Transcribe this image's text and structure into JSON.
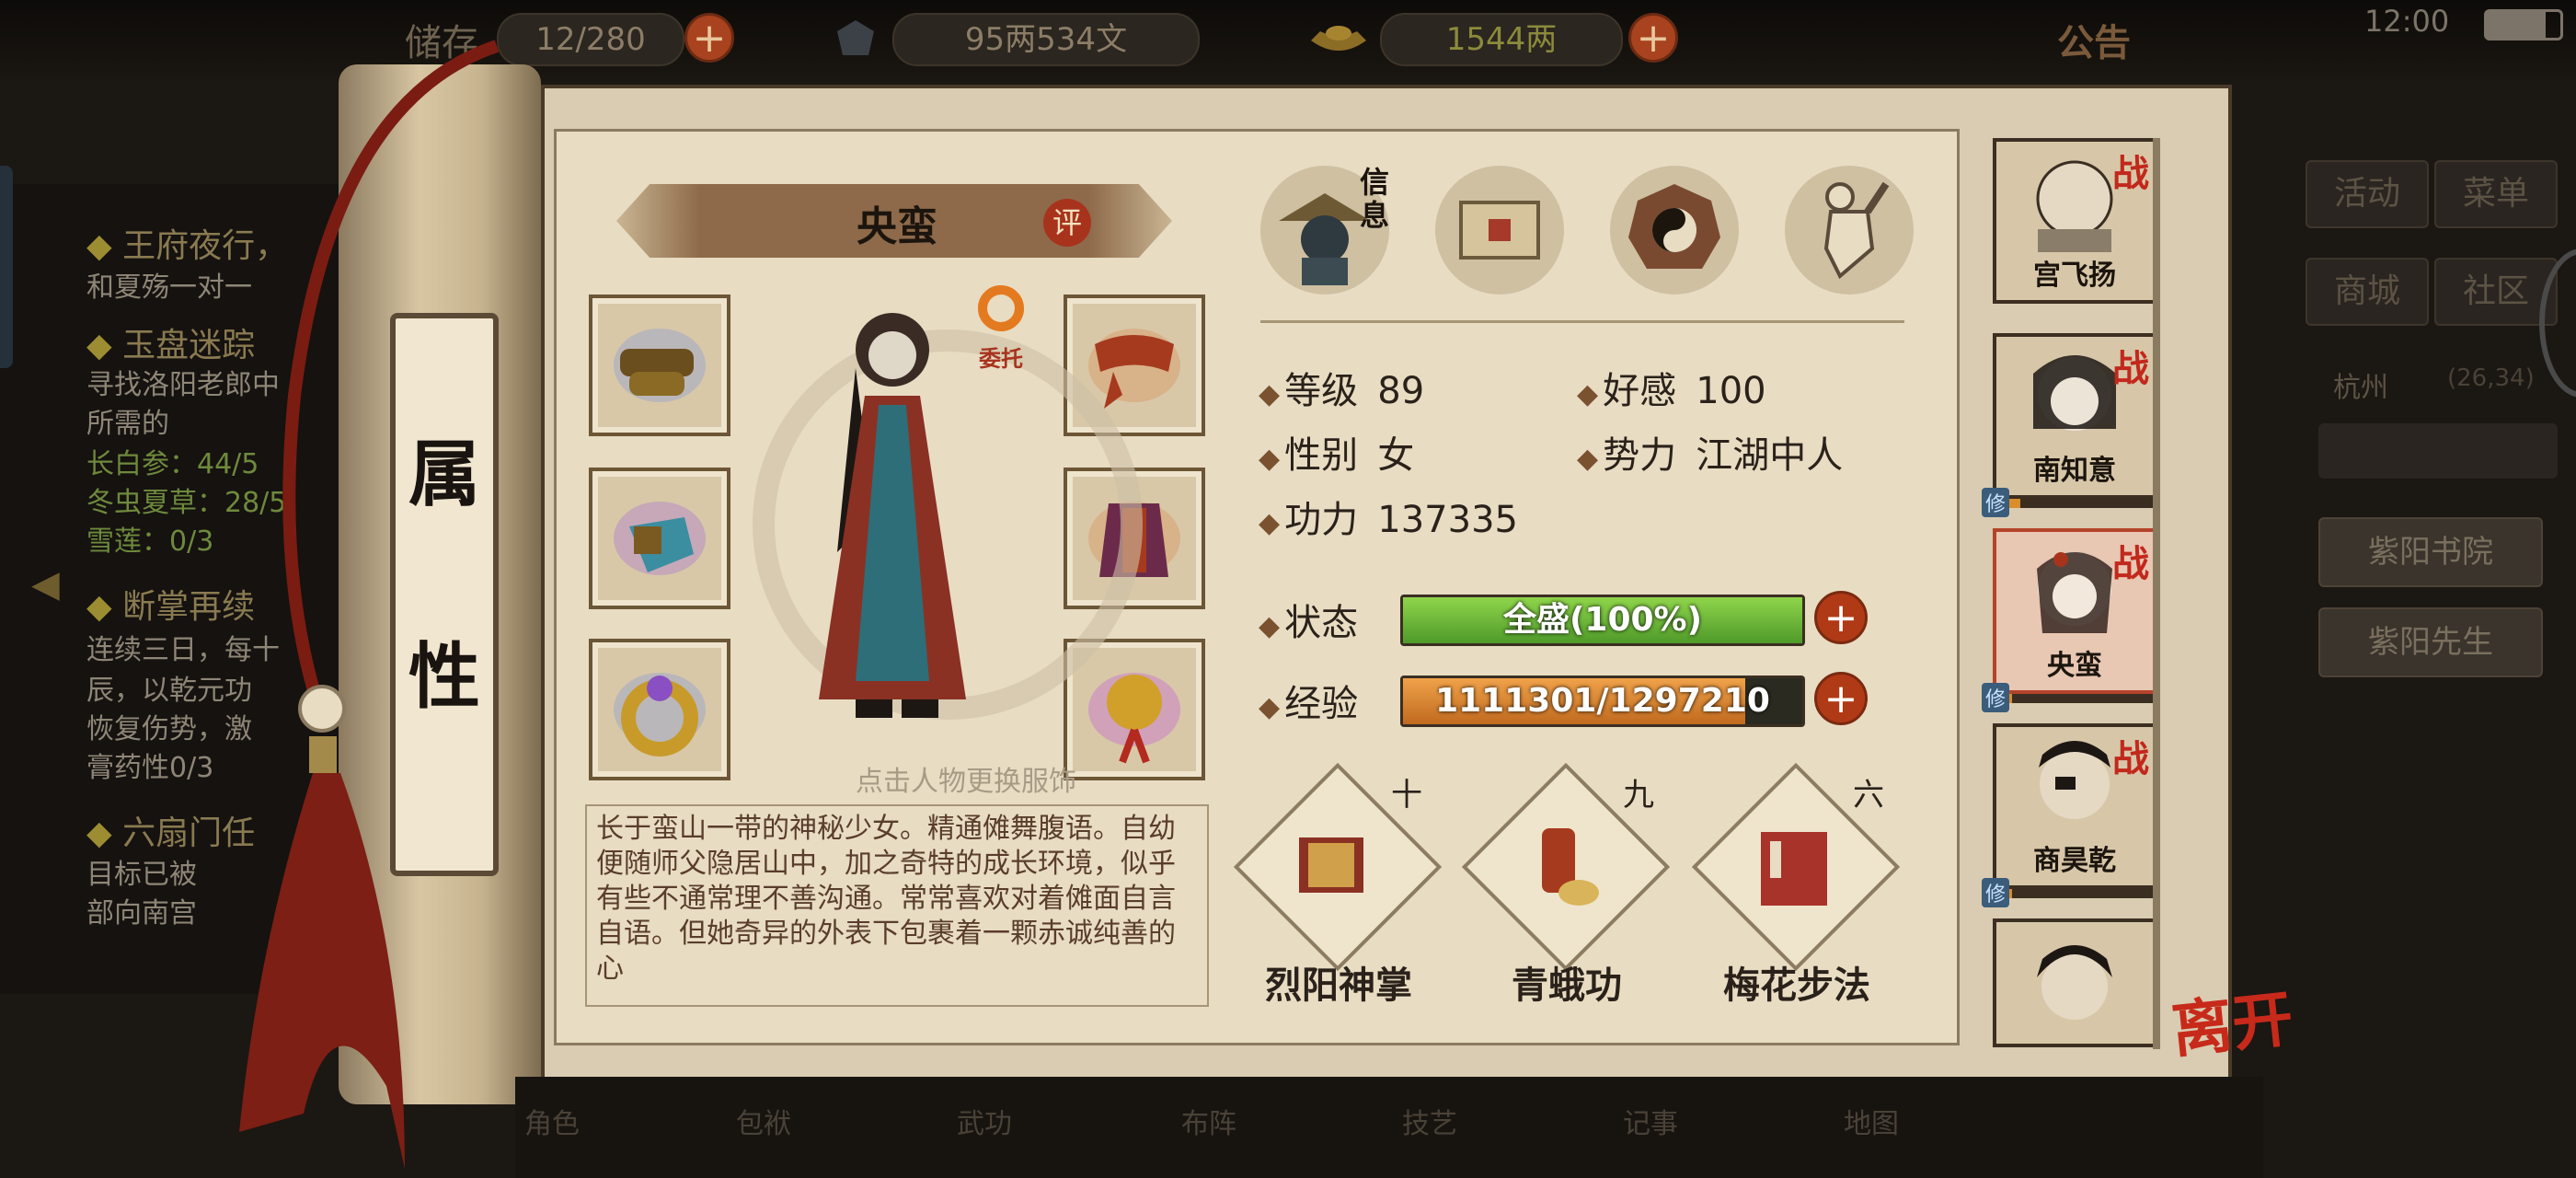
{
  "topbar": {
    "storage": "12/280",
    "money": "95两534文",
    "gold": "1544两",
    "announcement": "公告",
    "clock": "12:00"
  },
  "quests": [
    {
      "title": "王府夜行，",
      "body": [
        "和夏殇一对一"
      ]
    },
    {
      "title": "玉盘迷踪",
      "body": [
        "寻找洛阳老郎中",
        "所需的"
      ],
      "items": [
        "长白参：44/5",
        "冬虫夏草：28/5",
        "雪莲：0/3"
      ]
    },
    {
      "title": "断掌再续",
      "body": [
        "连续三日，每十",
        "辰，以乾元功",
        "恢复伤势，激",
        "膏药性0/3"
      ]
    },
    {
      "title": "六扇门任",
      "body": [
        "目标已被",
        "部向南宫"
      ]
    }
  ],
  "attr_tab": [
    "属",
    "性"
  ],
  "character": {
    "name": "央蛮",
    "eval": "评",
    "delegate": "委托",
    "change_hint": "点击人物更换服饰",
    "description": "长于蛮山一带的神秘少女。精通傩舞腹语。自幼便随师父隐居山中，加之奇特的成长环境，似乎有些不通常理不善沟通。常常喜欢对着傩面自言自语。但她奇异的外表下包裹着一颗赤诚纯善的心"
  },
  "tabs": {
    "info_label": "信息"
  },
  "stats": {
    "level_label": "等级",
    "level": "89",
    "affection_label": "好感",
    "affection": "100",
    "gender_label": "性别",
    "gender": "女",
    "faction_label": "势力",
    "faction": "江湖中人",
    "power_label": "功力",
    "power": "137335",
    "status_label": "状态",
    "status": "全盛(100%)",
    "status_fraction": 1.0,
    "exp_label": "经验",
    "exp": "1111301/1297210",
    "exp_fraction": 0.857
  },
  "skills": [
    {
      "name": "烈阳神掌",
      "level": "十"
    },
    {
      "name": "青蛾功",
      "level": "九"
    },
    {
      "name": "梅花步法",
      "level": "六"
    }
  ],
  "roster": [
    {
      "name": "宫飞扬",
      "battle": "战",
      "practice": "",
      "bar": 0
    },
    {
      "name": "南知意",
      "battle": "战",
      "practice": "修",
      "bar": 0.15
    },
    {
      "name": "央蛮",
      "battle": "战",
      "practice": "修",
      "bar": 0.1
    },
    {
      "name": "商昊乾",
      "battle": "战",
      "practice": "修",
      "bar": 0.1
    },
    {
      "name": "",
      "battle": "",
      "practice": "",
      "bar": 0
    }
  ],
  "leave": "离开",
  "side_menu": {
    "activity": "活动",
    "menu": "菜单",
    "shop": "商城",
    "society": "社区",
    "city": "杭州",
    "coords": "(26,34)",
    "loc1": "紫阳书院",
    "loc2": "紫阳先生"
  },
  "bottom_nav": [
    "角色",
    "包袱",
    "武功",
    "布阵",
    "技艺",
    "记事",
    "地图"
  ],
  "colors": {
    "accent_red": "#a8331d",
    "status_green": "#6fc03a",
    "exp_orange": "#e48a2b"
  }
}
